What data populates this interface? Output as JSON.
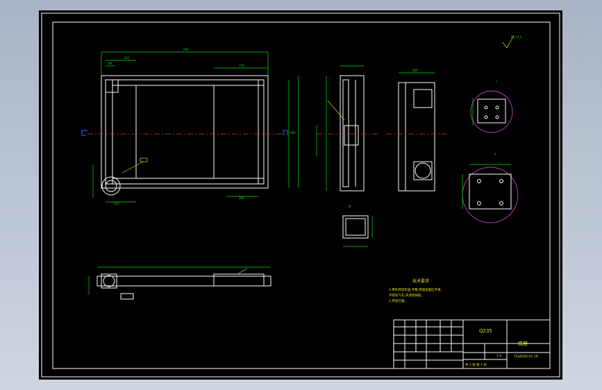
{
  "notes": {
    "title": "技术要求",
    "lines": [
      "1.零件焊接牢固,平整,焊缝表面应平滑,",
      "  不得有气孔,夹渣等缺陷。",
      "2.焊后打磨。"
    ]
  },
  "title_block": {
    "part_name": "底座",
    "drawing_no": "TSLB050-01-19",
    "material": "Q235",
    "scale": "1:4",
    "sheet": "共 1 张  第 1 张"
  },
  "view_labels": {
    "section_i": "I",
    "section_ii": "II",
    "section_iii": "III",
    "roughness": "Ra 12.5"
  }
}
